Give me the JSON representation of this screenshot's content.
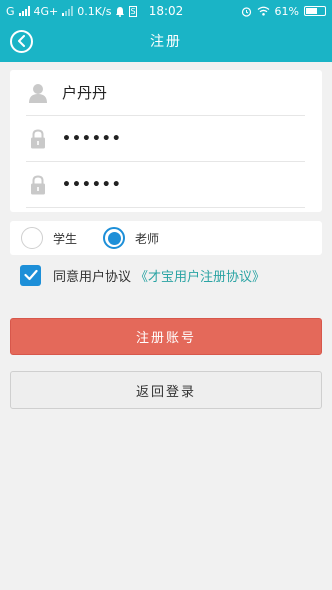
{
  "status_bar": {
    "carrier": "G",
    "network": "4G+",
    "speed": "0.1K/s",
    "sim_label": "S",
    "time": "18:02",
    "battery": "61%",
    "battery_level": 0.61
  },
  "header": {
    "title": "注册",
    "back_icon": "chevron-left-circle-icon"
  },
  "form": {
    "username": {
      "icon": "user-icon",
      "value": "户丹丹"
    },
    "password": {
      "icon": "lock-icon",
      "value": "••••••"
    },
    "confirm_password": {
      "icon": "lock-icon",
      "value": "••••••"
    }
  },
  "role": {
    "options": [
      {
        "label": "学生",
        "selected": false
      },
      {
        "label": "老师",
        "selected": true
      }
    ]
  },
  "agreement": {
    "checked": true,
    "text": "同意用户协议",
    "link": "《才宝用户注册协议》"
  },
  "buttons": {
    "register": "注册账号",
    "back_to_login": "返回登录"
  },
  "colors": {
    "brand": "#1ab4c6",
    "accent_blue": "#1d8fd8",
    "register_red": "#e4695a",
    "link_teal": "#2ba4a4"
  }
}
